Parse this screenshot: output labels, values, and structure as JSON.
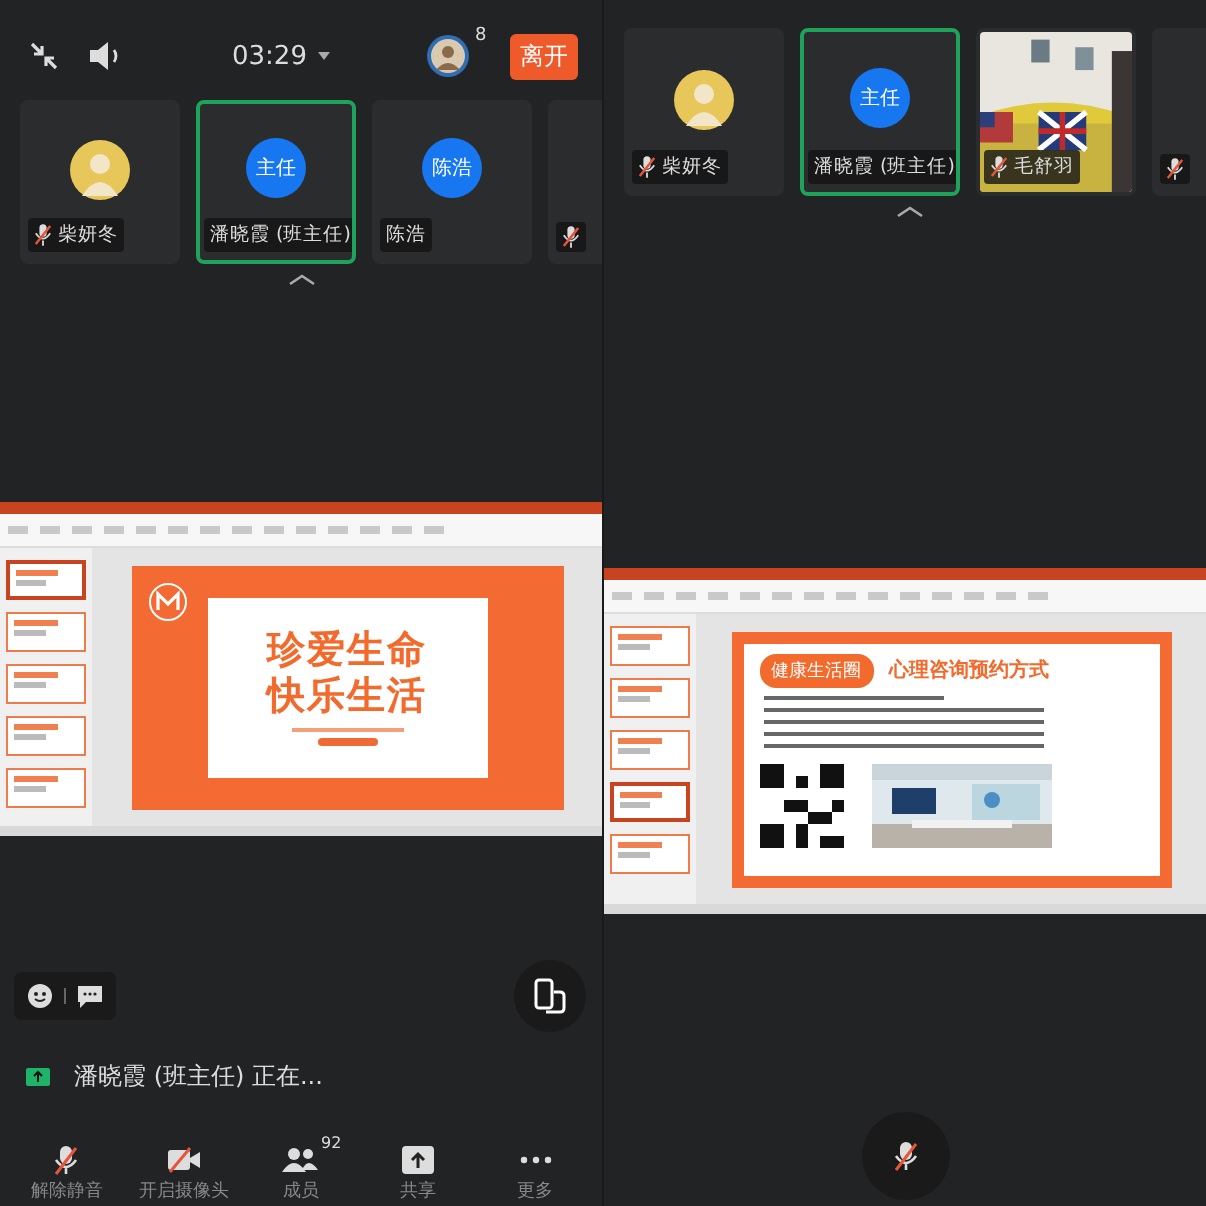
{
  "screens": [
    {
      "top_bar": {
        "timer": "03:29",
        "participant_count": "8",
        "leave_label": "离开"
      },
      "tiles": [
        {
          "name": "柴妍冬",
          "muted": true,
          "selected": false
        },
        {
          "kind": "initials",
          "initials": "主任",
          "name": "潘晓霞 (班主任)",
          "muted": false,
          "selected": true
        },
        {
          "kind": "initials",
          "initials": "陈浩",
          "name": "陈浩",
          "muted": false,
          "selected": false
        },
        {
          "kind": "partial",
          "muted": true,
          "selected": false
        }
      ],
      "slide": {
        "kind": "title",
        "lines": [
          "珍爱生命",
          "快乐生活"
        ]
      },
      "sharing_status": "潘晓霞 (班主任) 正在...",
      "toolbar": [
        {
          "kind": "mic-off",
          "label": "解除静音"
        },
        {
          "kind": "camera-off",
          "label": "开启摄像头"
        },
        {
          "kind": "members",
          "label": "成员",
          "badge": "92"
        },
        {
          "kind": "share",
          "label": "共享"
        },
        {
          "kind": "more",
          "label": "更多"
        }
      ]
    },
    {
      "tiles": [
        {
          "name": "柴妍冬",
          "muted": true,
          "selected": false
        },
        {
          "kind": "initials",
          "initials": "主任",
          "name": "潘晓霞 (班主任)",
          "muted": false,
          "selected": true
        },
        {
          "kind": "video",
          "name": "毛舒羽",
          "muted": true,
          "selected": false
        },
        {
          "kind": "partial",
          "muted": true,
          "selected": false
        }
      ],
      "slide": {
        "kind": "info",
        "tag": "健康生活圈",
        "heading": "心理咨询预约方式"
      },
      "mic_button": {
        "muted": true
      }
    }
  ]
}
